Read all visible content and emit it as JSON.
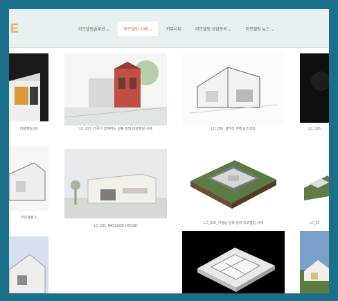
{
  "brand": {
    "logo": "E"
  },
  "nav": {
    "items": [
      {
        "label": "리모델링솔루션 ⌄",
        "active": false
      },
      {
        "label": "리모델링 사례 ⌄",
        "active": true
      },
      {
        "label": "커뮤니티",
        "active": false
      },
      {
        "label": "리모델링 상담문의 ⌄",
        "active": false
      },
      {
        "label": "리모델링 뉴스 ⌄",
        "active": false
      }
    ]
  },
  "gallery": {
    "items": [
      {
        "caption": "리모델링 (8)"
      },
      {
        "caption": "LC_027_가족이 함께하는 설봉 빌딩 리모델링 사례"
      },
      {
        "caption": "LC_026_설악산 주택 & 리조트"
      },
      {
        "caption": "LC_026"
      },
      {
        "caption": "리모델링 5"
      },
      {
        "caption": "LC_031_PASSAGE HOUSE"
      },
      {
        "caption": "LC_025_석정동 양옥 빌라 리모델링 사례"
      },
      {
        "caption": "LC_02"
      }
    ]
  },
  "colors": {
    "frame": "#1a6f8a",
    "nav_bg": "#e9f0f1",
    "accent": "#d06b2a",
    "logo": "#d9b45e"
  },
  "icons": [
    "chevron-down-icon"
  ]
}
